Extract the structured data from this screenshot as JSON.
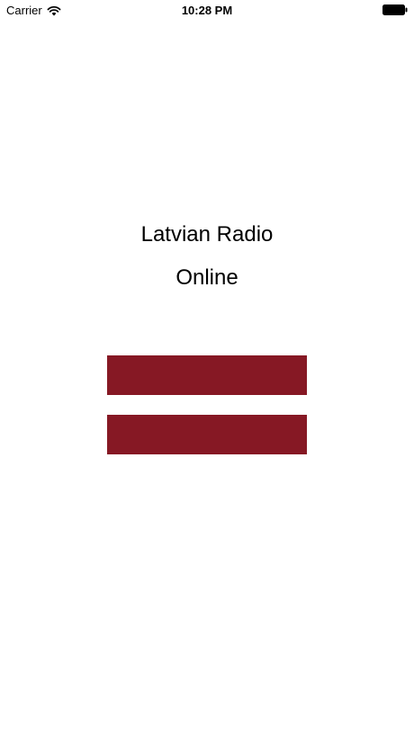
{
  "status_bar": {
    "carrier": "Carrier",
    "time": "10:28 PM",
    "wifi_icon": "wifi-icon",
    "battery_icon": "battery-icon"
  },
  "app": {
    "title_line_1": "Latvian Radio",
    "title_line_2": "Online"
  },
  "flag": {
    "name": "latvian-flag",
    "stripe_color": "#861824"
  }
}
